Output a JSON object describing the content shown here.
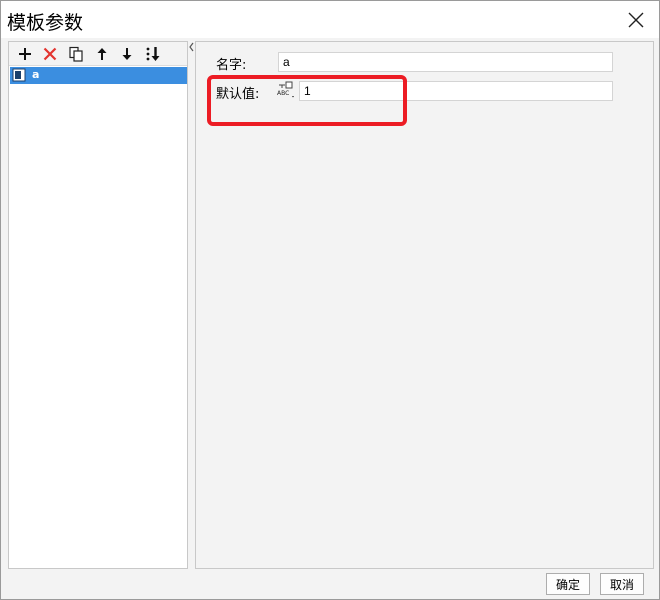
{
  "window": {
    "title": "模板参数",
    "close_icon": "close-icon"
  },
  "toolbar": {
    "buttons": [
      {
        "name": "add",
        "icon": "plus-icon"
      },
      {
        "name": "delete",
        "icon": "x-icon",
        "color": "#e3342f"
      },
      {
        "name": "copy",
        "icon": "copy-icon"
      },
      {
        "name": "move-up",
        "icon": "arrow-up-icon"
      },
      {
        "name": "move-down",
        "icon": "arrow-down-icon"
      },
      {
        "name": "sort",
        "icon": "sort-icon"
      }
    ]
  },
  "parameter_list": {
    "items": [
      {
        "label": "a",
        "selected": true
      }
    ],
    "selected_color": "#3b8ee0"
  },
  "details": {
    "name_label": "名字:",
    "name_value": "a",
    "default_label": "默认值:",
    "default_value": "1",
    "type_icon": "abc-type-icon"
  },
  "highlight_color": "#ec1c24",
  "footer": {
    "ok_label": "确定",
    "cancel_label": "取消"
  }
}
